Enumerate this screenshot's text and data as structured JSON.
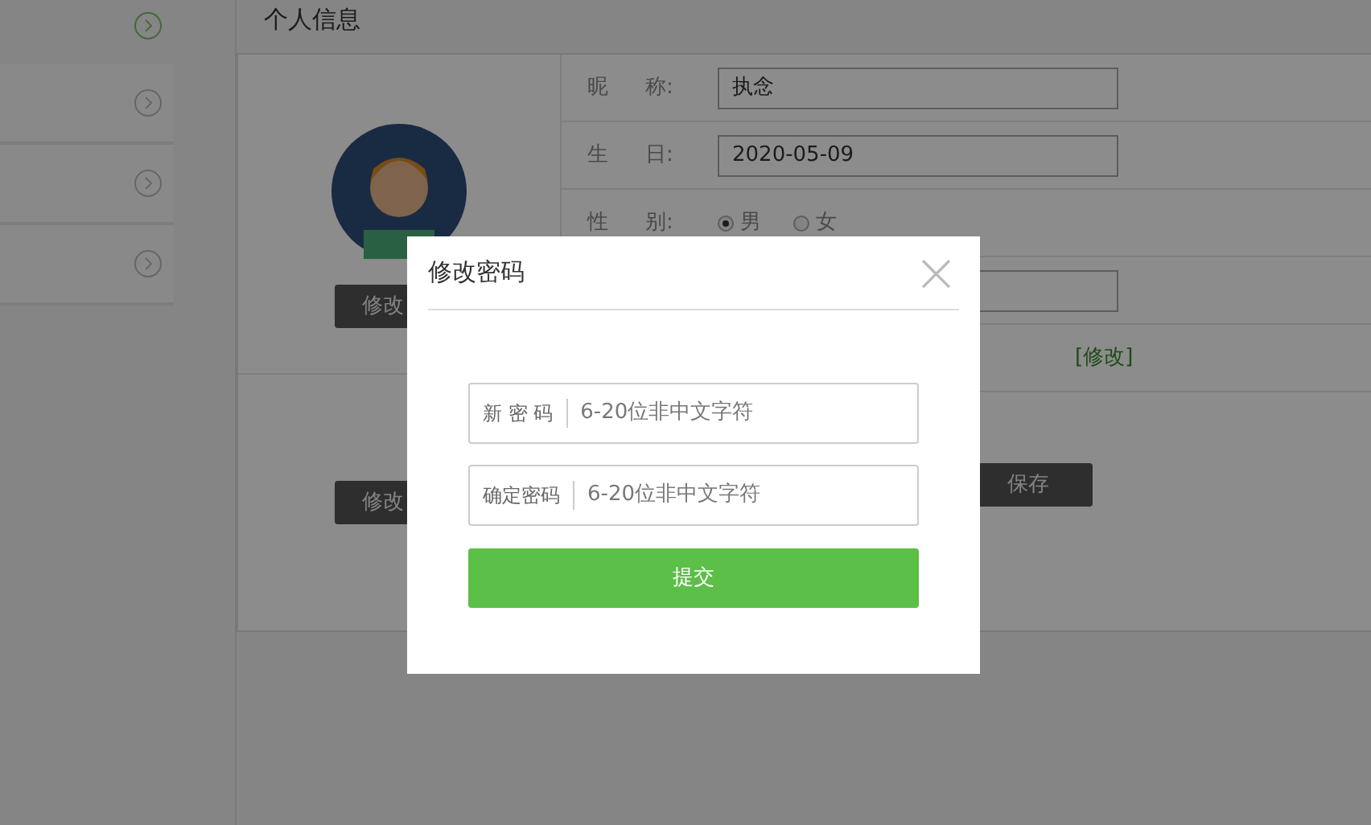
{
  "sidebar": {
    "items": [
      {
        "kind": "header"
      },
      {
        "kind": "item"
      },
      {
        "kind": "item"
      },
      {
        "kind": "item"
      }
    ]
  },
  "panel": {
    "title": "个人信息",
    "avatar_button": "修改",
    "password_button": "修改",
    "fields": [
      {
        "kind": "text",
        "label_1": "昵",
        "label_2": "称:",
        "value": "执念"
      },
      {
        "kind": "text",
        "label_1": "生",
        "label_2": "日:",
        "value": "2020-05-09"
      },
      {
        "kind": "radio",
        "label_1": "性",
        "label_2": "别:",
        "options": [
          {
            "label": "男",
            "selected": true
          },
          {
            "label": "女",
            "selected": false
          }
        ]
      },
      {
        "kind": "text"
      },
      {
        "kind": "link",
        "link": "[修改]"
      }
    ],
    "save_button": "保存"
  },
  "dialog": {
    "title": "修改密码",
    "close": "×",
    "inputs": [
      {
        "label": "新 密 码",
        "placeholder": "6-20位非中文字符"
      },
      {
        "label": "确定密码",
        "placeholder": "6-20位非中文字符"
      }
    ],
    "submit": "提交"
  }
}
